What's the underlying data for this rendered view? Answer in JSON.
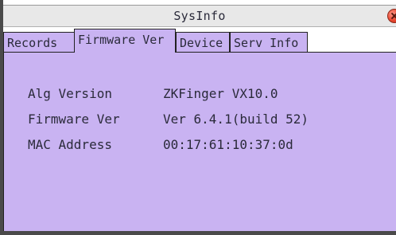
{
  "window": {
    "title": "SysInfo",
    "close_icon": "close-icon"
  },
  "tabs": [
    {
      "label": "Records",
      "active": false
    },
    {
      "label": "Firmware Ver",
      "active": true
    },
    {
      "label": "Device",
      "active": false
    },
    {
      "label": "Serv Info",
      "active": false
    }
  ],
  "info": [
    {
      "label": "Alg Version",
      "value": "ZKFinger VX10.0"
    },
    {
      "label": "Firmware Ver",
      "value": "Ver 6.4.1(build 52)"
    },
    {
      "label": "MAC Address",
      "value": "00:17:61:10:37:0d"
    }
  ],
  "colors": {
    "panel": "#c9b3f2",
    "close": "#e8452e"
  }
}
